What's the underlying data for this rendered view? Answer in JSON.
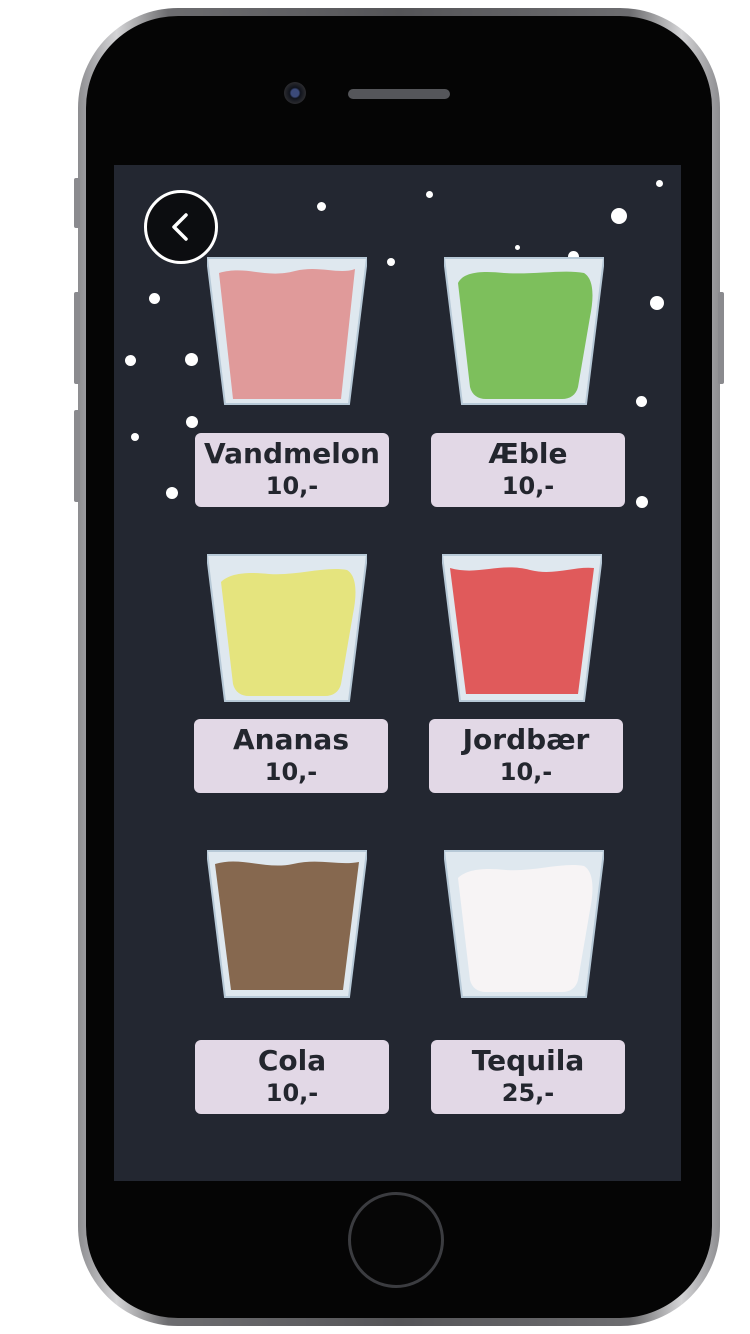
{
  "back_button": {
    "icon": "chevron-left-icon"
  },
  "colors": {
    "screen_bg": "#232731",
    "card_bg": "#e2d8e6",
    "card_text": "#23262e",
    "glass_rim": "#dfe8ef",
    "glass_edge": "#b7c9d7"
  },
  "drinks": [
    {
      "name": "Vandmelon",
      "price": "10,-",
      "liquid_color": "#e09a9a"
    },
    {
      "name": "Æble",
      "price": "10,-",
      "liquid_color": "#7dbf5c"
    },
    {
      "name": "Ananas",
      "price": "10,-",
      "liquid_color": "#e5e47e"
    },
    {
      "name": "Jordbær",
      "price": "10,-",
      "liquid_color": "#e05a5b"
    },
    {
      "name": "Cola",
      "price": "10,-",
      "liquid_color": "#86684f"
    },
    {
      "name": "Tequila",
      "price": "25,-",
      "liquid_color": "#f7f4f5"
    }
  ]
}
